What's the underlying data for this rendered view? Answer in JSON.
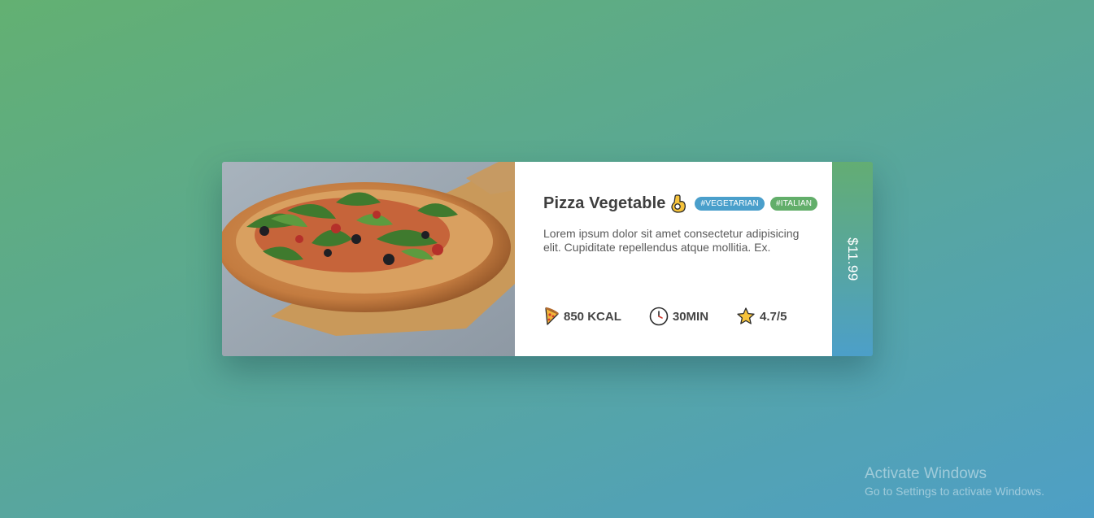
{
  "card": {
    "title": "Pizza Vegetable",
    "title_icon": "ok-hand-icon",
    "tags": [
      "#VEGETARIAN",
      "#ITALIAN"
    ],
    "description": "Lorem ipsum dolor sit amet consectetur adipisicing elit. Cupiditate repellendus atque mollitia. Ex.",
    "stats": {
      "calories": {
        "icon": "pizza-slice-icon",
        "value": "850 KCAL"
      },
      "time": {
        "icon": "clock-icon",
        "value": "30MIN"
      },
      "rating": {
        "icon": "star-icon",
        "value": "4.7/5"
      }
    },
    "price": "$11.99",
    "image": "pizza-photo"
  },
  "colors": {
    "tag_vegetarian": "#4a9fcb",
    "tag_italian": "#62ae6a",
    "background_start": "#63b072",
    "background_end": "#4e9fc6"
  },
  "watermark": {
    "title": "Activate Windows",
    "subtitle": "Go to Settings to activate Windows."
  }
}
